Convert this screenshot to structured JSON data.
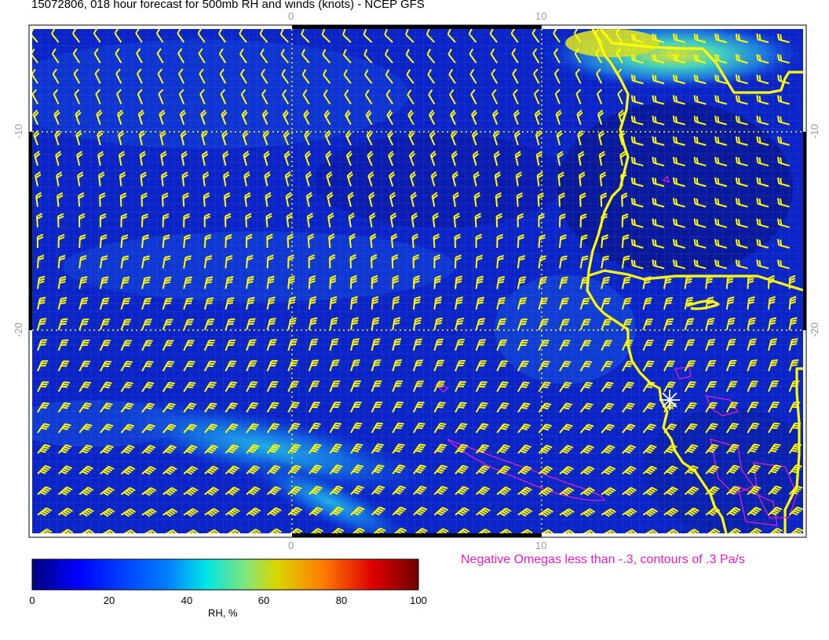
{
  "title": "15072806, 018 hour forecast for 500mb RH and winds (knots) - NCEP GFS",
  "omega_note": "Negative Omegas less than -.3, contours of .3 Pa/s",
  "colorbar": {
    "label": "RH, %",
    "ticks": [
      "0",
      "20",
      "40",
      "60",
      "80",
      "100"
    ],
    "colors": [
      "#00007f",
      "#0000ff",
      "#007fff",
      "#00ffff",
      "#7fff7f",
      "#ffff00",
      "#ff7f00",
      "#ff0000",
      "#7f0000"
    ]
  },
  "axes": {
    "x_labels": [
      "0",
      "10"
    ],
    "y_labels": [
      "-10",
      "-20"
    ]
  },
  "colors": {
    "barbs": "#ffff00",
    "coast": "#ffff00",
    "omega": "#e020c8",
    "grid": "#ffff00"
  }
}
